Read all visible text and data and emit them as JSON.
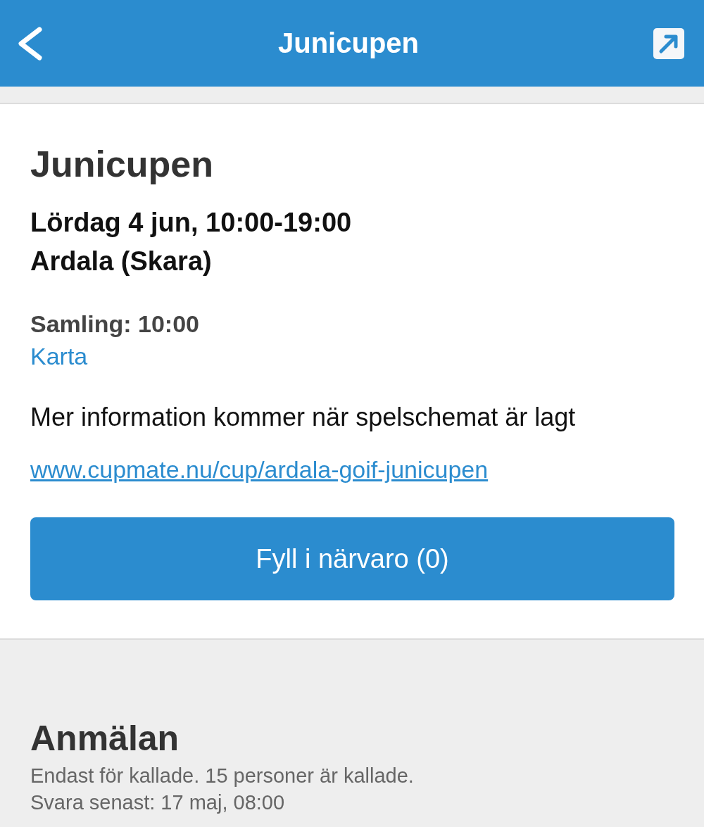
{
  "header": {
    "title": "Junicupen"
  },
  "event": {
    "title": "Junicupen",
    "datetime": "Lördag 4 jun, 10:00-19:00",
    "location": "Ardala (Skara)",
    "gathering": "Samling: 10:00",
    "map_link": "Karta",
    "description": "Mer information kommer när spelschemat är lagt",
    "url": "www.cupmate.nu/cup/ardala-goif-junicupen",
    "attendance_button": "Fyll i närvaro (0)"
  },
  "registration": {
    "title": "Anmälan",
    "lines": [
      "Endast för kallade. 15 personer är kallade.",
      "Svara senast: 17 maj, 08:00"
    ]
  }
}
